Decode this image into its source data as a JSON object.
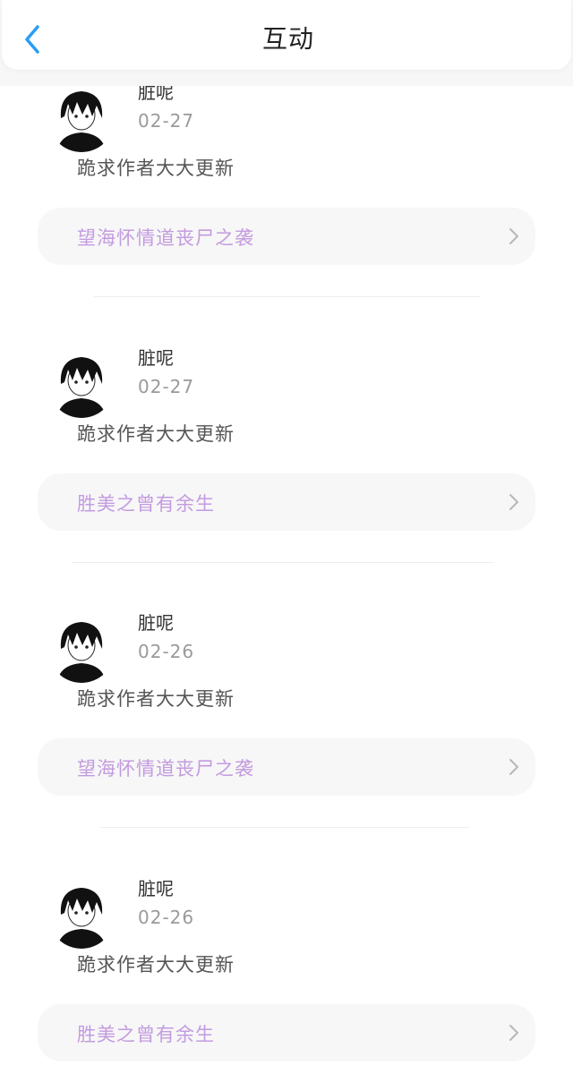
{
  "header": {
    "title": "互动",
    "back_icon": "chevron-left-icon",
    "accent": "#2a9df4"
  },
  "colors": {
    "book_title": "#c39be0",
    "divider": "#eeeeee"
  },
  "items": [
    {
      "username": "脏呢",
      "date": "02-27",
      "comment": "跪求作者大大更新",
      "book": "望海怀情道丧尸之袭"
    },
    {
      "username": "脏呢",
      "date": "02-27",
      "comment": "跪求作者大大更新",
      "book": "胜美之曾有余生"
    },
    {
      "username": "脏呢",
      "date": "02-26",
      "comment": "跪求作者大大更新",
      "book": "望海怀情道丧尸之袭"
    },
    {
      "username": "脏呢",
      "date": "02-26",
      "comment": "跪求作者大大更新",
      "book": "胜美之曾有余生"
    }
  ]
}
